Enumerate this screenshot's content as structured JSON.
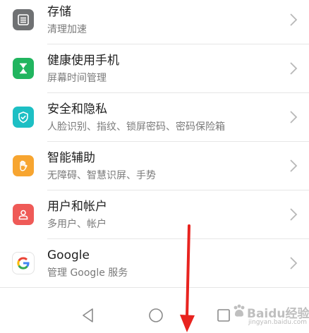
{
  "settings": {
    "items": [
      {
        "title": "存储",
        "subtitle": "清理加速",
        "icon": "storage-icon",
        "icon_color": "#6f7173"
      },
      {
        "title": "健康使用手机",
        "subtitle": "屏幕时间管理",
        "icon": "hourglass-icon",
        "icon_color": "#21b55f"
      },
      {
        "title": "安全和隐私",
        "subtitle": "人脸识别、指纹、锁屏密码、密码保险箱",
        "icon": "shield-icon",
        "icon_color": "#1dbfc4"
      },
      {
        "title": "智能辅助",
        "subtitle": "无障碍、智慧识屏、手势",
        "icon": "hand-icon",
        "icon_color": "#f7a530"
      },
      {
        "title": "用户和帐户",
        "subtitle": "多用户、帐户",
        "icon": "user-icon",
        "icon_color": "#ef5a57"
      },
      {
        "title": "Google",
        "subtitle": "管理 Google 服务",
        "icon": "google-icon",
        "icon_color": "#4285f4"
      }
    ]
  },
  "navbar": {
    "back": "back-icon",
    "home": "home-icon",
    "recents": "recents-icon"
  },
  "annotation": {
    "arrow_color": "#e8231f"
  },
  "watermark": {
    "text": "Baidu经验",
    "sub": "jingyan.baidu.com"
  }
}
